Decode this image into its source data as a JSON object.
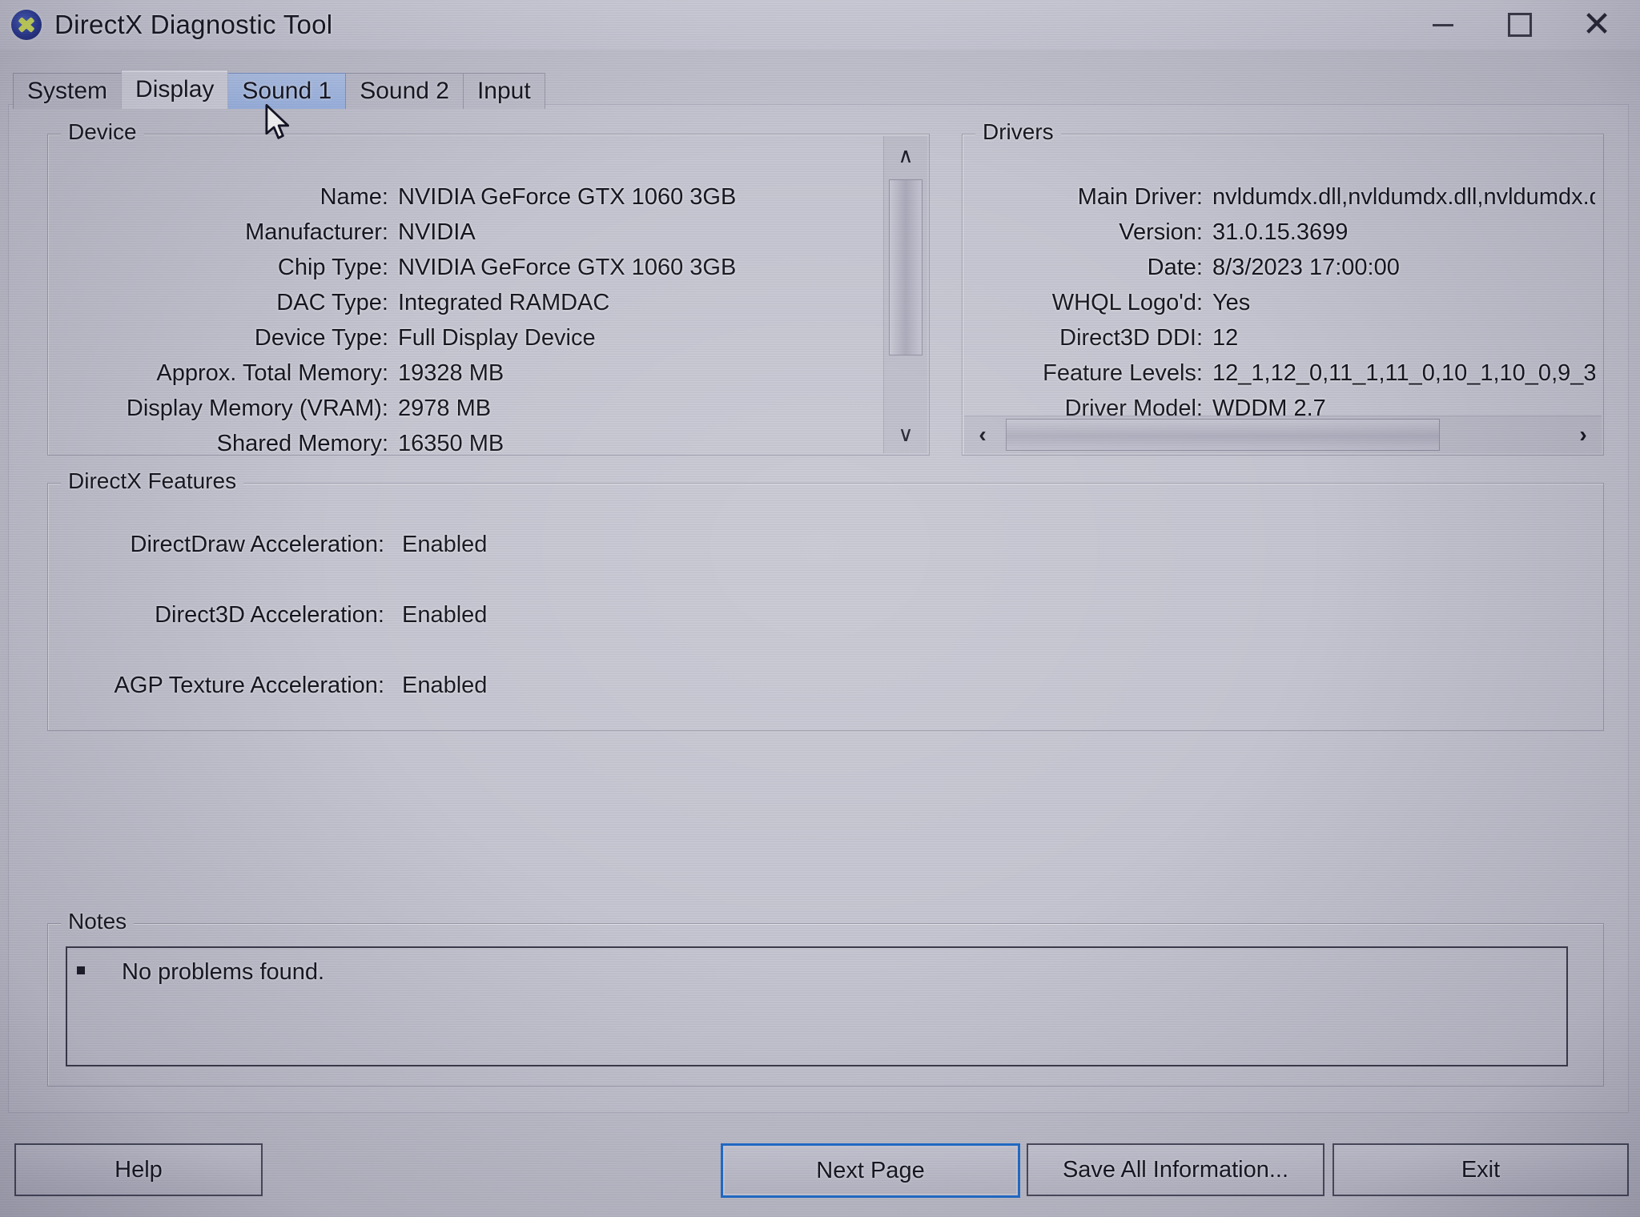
{
  "window": {
    "title": "DirectX Diagnostic Tool",
    "logo_icon": "directx-logo-icon",
    "minimize_label": "–",
    "maximize_label": "□",
    "close_label": "✕"
  },
  "tabs": [
    {
      "label": "System",
      "state": "normal"
    },
    {
      "label": "Display",
      "state": "selected"
    },
    {
      "label": "Sound 1",
      "state": "hover"
    },
    {
      "label": "Sound 2",
      "state": "normal"
    },
    {
      "label": "Input",
      "state": "normal"
    }
  ],
  "device": {
    "legend": "Device",
    "rows": [
      {
        "key": "Name:",
        "value": "NVIDIA GeForce GTX 1060 3GB"
      },
      {
        "key": "Manufacturer:",
        "value": "NVIDIA"
      },
      {
        "key": "Chip Type:",
        "value": "NVIDIA GeForce GTX 1060 3GB"
      },
      {
        "key": "DAC Type:",
        "value": "Integrated RAMDAC"
      },
      {
        "key": "Device Type:",
        "value": "Full Display Device"
      },
      {
        "key": "Approx. Total Memory:",
        "value": "19328 MB"
      },
      {
        "key": "Display Memory (VRAM):",
        "value": "2978 MB"
      },
      {
        "key": "Shared Memory:",
        "value": "16350 MB"
      }
    ],
    "scrollbar": {
      "up_arrow": "∧",
      "down_arrow": "∨"
    }
  },
  "drivers": {
    "legend": "Drivers",
    "rows": [
      {
        "key": "Main Driver:",
        "value": "nvldumdx.dll,nvldumdx.dll,nvldumdx.d"
      },
      {
        "key": "Version:",
        "value": "31.0.15.3699"
      },
      {
        "key": "Date:",
        "value": "8/3/2023 17:00:00"
      },
      {
        "key": "WHQL Logo'd:",
        "value": "Yes"
      },
      {
        "key": "Direct3D DDI:",
        "value": "12"
      },
      {
        "key": "Feature Levels:",
        "value": "12_1,12_0,11_1,11_0,10_1,10_0,9_3"
      },
      {
        "key": "Driver Model:",
        "value": "WDDM 2.7"
      }
    ],
    "scrollbar": {
      "left_arrow": "‹",
      "right_arrow": "›"
    }
  },
  "directx_features": {
    "legend": "DirectX Features",
    "rows": [
      {
        "key": "DirectDraw Acceleration:",
        "value": "Enabled"
      },
      {
        "key": "Direct3D Acceleration:",
        "value": "Enabled"
      },
      {
        "key": "AGP Texture Acceleration:",
        "value": "Enabled"
      }
    ]
  },
  "notes": {
    "legend": "Notes",
    "items": [
      "No problems found."
    ]
  },
  "buttons": {
    "help": "Help",
    "next_page": "Next Page",
    "save_all": "Save All Information...",
    "exit": "Exit"
  },
  "colors": {
    "window_face": "#c6c6d2",
    "tab_hover": "#9fb8e6",
    "focus_border": "#1f6fd0",
    "text": "#14141e"
  }
}
